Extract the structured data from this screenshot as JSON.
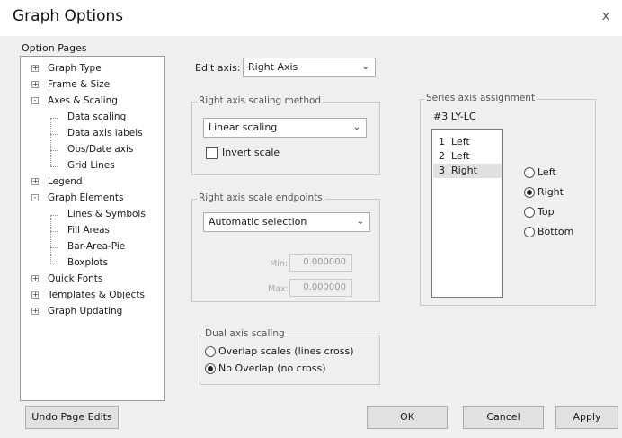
{
  "window": {
    "title": "Graph Options",
    "close_symbol": "x"
  },
  "option_pages": {
    "label": "Option Pages",
    "items": [
      {
        "label": "Graph Type",
        "expander": "+"
      },
      {
        "label": "Frame & Size",
        "expander": "+"
      },
      {
        "label": "Axes & Scaling",
        "expander": "-"
      },
      {
        "label": "Data scaling"
      },
      {
        "label": "Data axis labels"
      },
      {
        "label": "Obs/Date axis"
      },
      {
        "label": "Grid Lines"
      },
      {
        "label": "Legend",
        "expander": "+"
      },
      {
        "label": "Graph Elements",
        "expander": "-"
      },
      {
        "label": "Lines & Symbols"
      },
      {
        "label": "Fill Areas"
      },
      {
        "label": "Bar-Area-Pie"
      },
      {
        "label": "Boxplots"
      },
      {
        "label": "Quick Fonts",
        "expander": "+"
      },
      {
        "label": "Templates & Objects",
        "expander": "+"
      },
      {
        "label": "Graph Updating",
        "expander": "+"
      }
    ]
  },
  "edit_axis": {
    "label": "Edit axis:",
    "value": "Right Axis"
  },
  "scaling_method": {
    "group_label": "Right axis scaling method",
    "value": "Linear scaling",
    "invert_label": "Invert scale",
    "invert_checked": false
  },
  "endpoints": {
    "group_label": "Right axis scale endpoints",
    "value": "Automatic selection",
    "min_label": "Min:",
    "min_value": "0.000000",
    "max_label": "Max:",
    "max_value": "0.000000"
  },
  "dual_axis": {
    "group_label": "Dual axis scaling",
    "options": [
      {
        "label": "Overlap scales (lines cross)",
        "selected": false
      },
      {
        "label": "No Overlap (no cross)",
        "selected": true
      }
    ]
  },
  "series_assignment": {
    "group_label": "Series axis assignment",
    "series_name": "#3 LY-LC",
    "rows": [
      {
        "text": "1  Left",
        "selected": false
      },
      {
        "text": "2  Left",
        "selected": false
      },
      {
        "text": "3  Right",
        "selected": true
      }
    ],
    "axis_options": [
      {
        "label": "Left",
        "selected": false
      },
      {
        "label": "Right",
        "selected": true
      },
      {
        "label": "Top",
        "selected": false
      },
      {
        "label": "Bottom",
        "selected": false
      }
    ]
  },
  "buttons": {
    "undo": "Undo Page Edits",
    "ok": "OK",
    "cancel": "Cancel",
    "apply": "Apply"
  }
}
